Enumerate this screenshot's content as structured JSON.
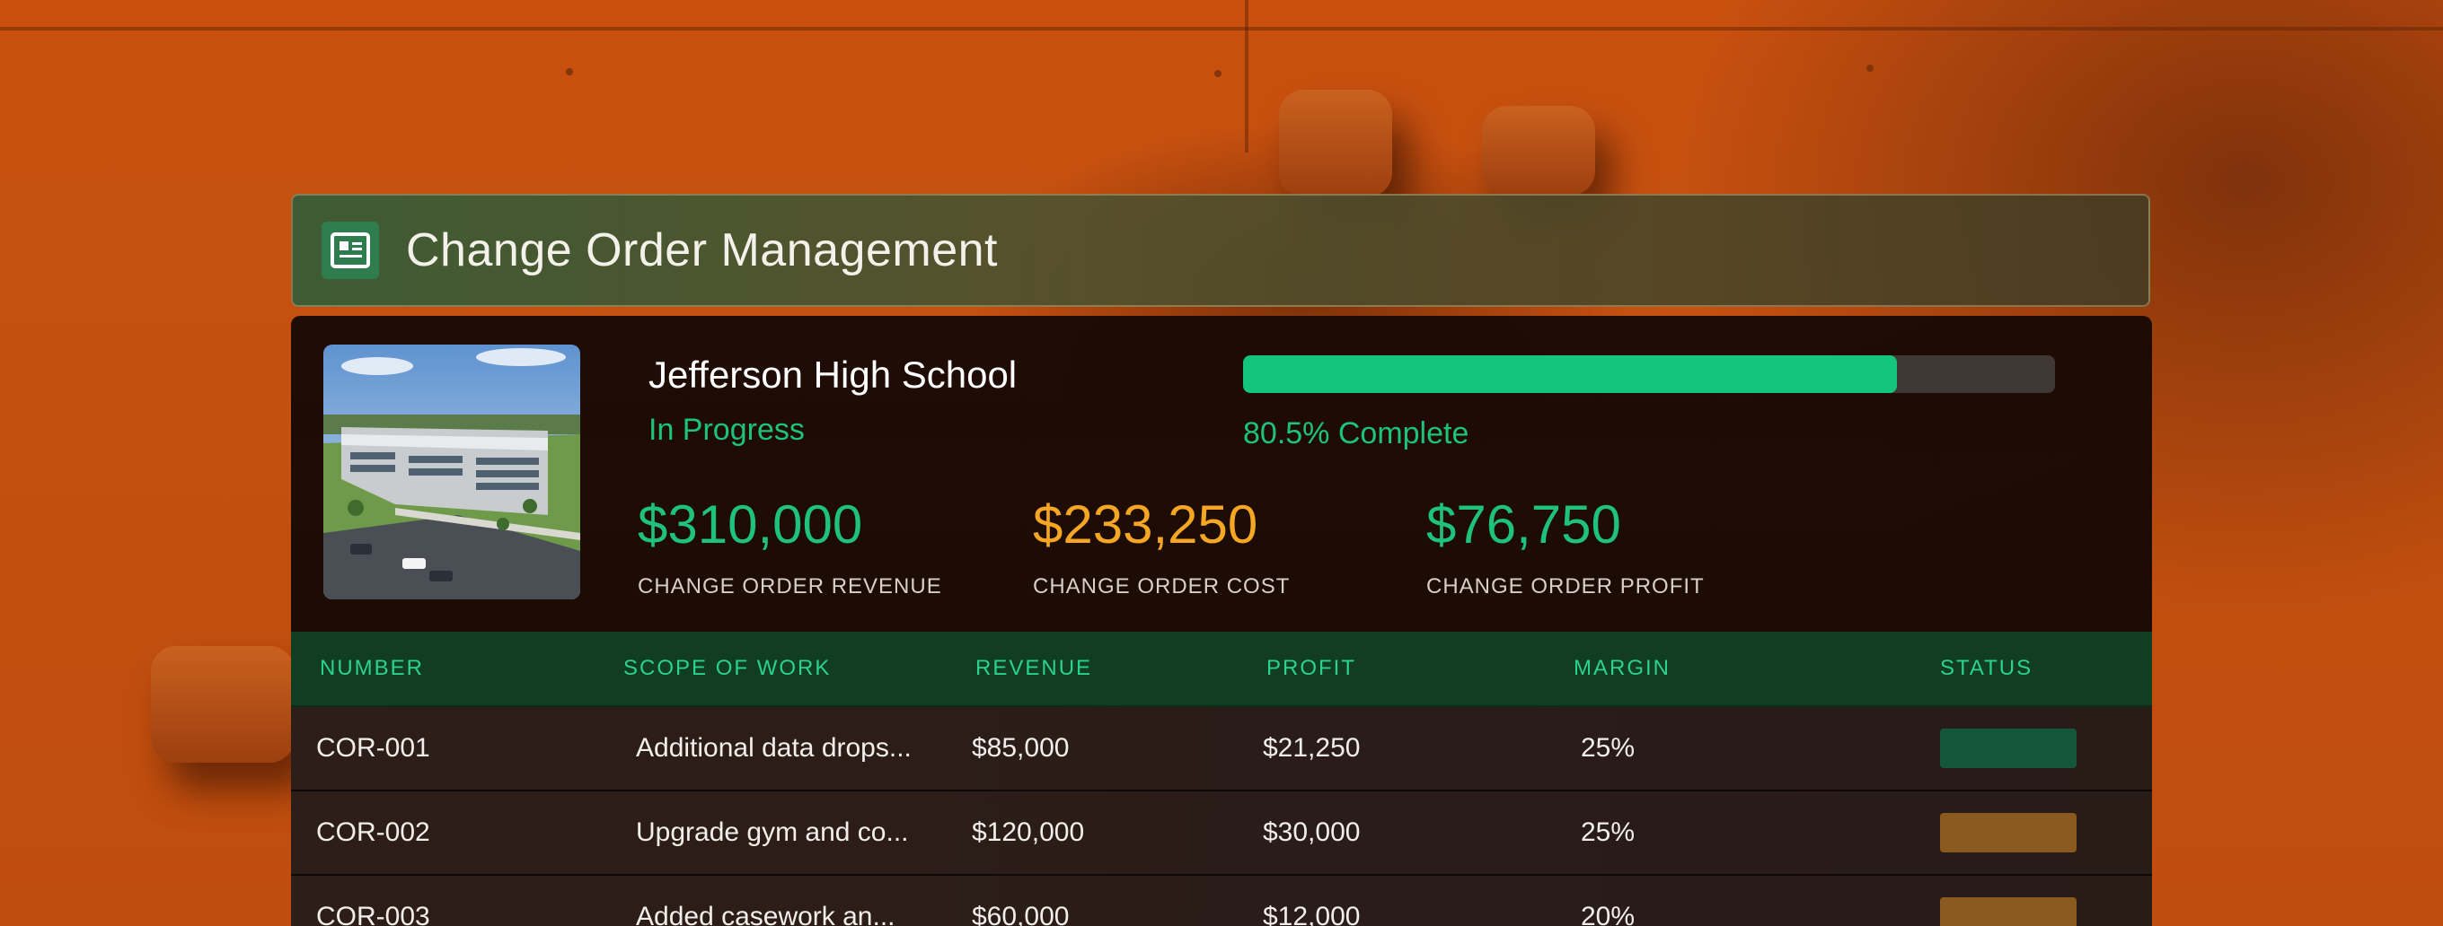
{
  "header": {
    "title": "Change Order Management",
    "icon": "newspaper-icon"
  },
  "project": {
    "name": "Jefferson High School",
    "status": "In Progress",
    "progress_percent": 80.5,
    "progress_label": "80.5% Complete",
    "image": "school-building-photo"
  },
  "metrics": [
    {
      "value": "$310,000",
      "label": "CHANGE ORDER REVENUE",
      "color": "#1fc27a"
    },
    {
      "value": "$233,250",
      "label": "CHANGE ORDER COST",
      "color": "#f5a623"
    },
    {
      "value": "$76,750",
      "label": "CHANGE ORDER PROFIT",
      "color": "#1fc27a"
    }
  ],
  "table": {
    "columns": [
      "NUMBER",
      "SCOPE OF WORK",
      "REVENUE",
      "PROFIT",
      "MARGIN",
      "STATUS"
    ],
    "rows": [
      {
        "number": "COR-001",
        "scope": "Additional data drops...",
        "revenue": "$85,000",
        "profit": "$21,250",
        "margin": "25%",
        "status_color": "#14573a"
      },
      {
        "number": "COR-002",
        "scope": "Upgrade gym and co...",
        "revenue": "$120,000",
        "profit": "$30,000",
        "margin": "25%",
        "status_color": "#8a5a1e"
      },
      {
        "number": "COR-003",
        "scope": "Added casework an...",
        "revenue": "$60,000",
        "profit": "$12,000",
        "margin": "20%",
        "status_color": "#8a5a1e"
      }
    ]
  }
}
